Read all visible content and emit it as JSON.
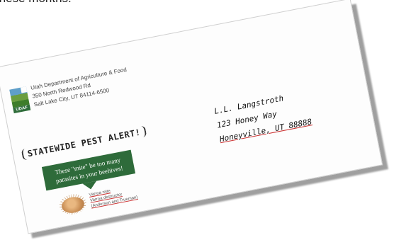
{
  "header_snippet": "these months.",
  "letterhead": {
    "logo_text": "UDAF",
    "org": "Utah Department of Agriculture & Food",
    "street": "350 North Redwood Rd",
    "city": "Salt Lake City, UT  84114-6500"
  },
  "alert": {
    "label": "STATEWIDE PEST ALERT!"
  },
  "bubble": {
    "line1": "These \"mite\" be too many",
    "line2": "parasites in your beehives!"
  },
  "mite_caption": {
    "line1": "Varroa mite",
    "line2": "Varroa destructor",
    "line3": "(Anderson and Trueman)"
  },
  "recipient": {
    "name": "L.L. Langstroth",
    "street": "123 Honey Way",
    "city": "Honeyville, UT 88888"
  },
  "colors": {
    "bubble_green": "#2e6b3a",
    "underline_red": "#cc3333"
  }
}
